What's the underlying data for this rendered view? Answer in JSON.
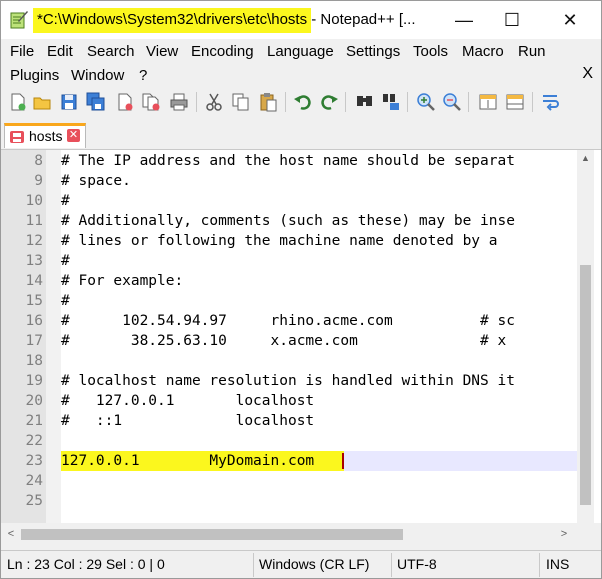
{
  "titlebar": {
    "title": "*C:\\Windows\\System32\\drivers\\etc\\hosts",
    "app_suffix": " - Notepad++ [...",
    "min": "—",
    "max": "☐",
    "close": "✕"
  },
  "menu": {
    "row1": [
      "File",
      "Edit",
      "Search",
      "View",
      "Encoding",
      "Language",
      "Settings",
      "Tools",
      "Macro",
      "Run"
    ],
    "row2": [
      "Plugins",
      "Window",
      "?"
    ],
    "close_doc": "X"
  },
  "toolbar": {
    "icons": [
      "new-file-icon",
      "open-file-icon",
      "save-icon",
      "save-all-icon",
      "close-icon",
      "close-all-icon",
      "print-icon",
      "cut-icon",
      "copy-icon",
      "paste-icon",
      "undo-icon",
      "redo-icon",
      "find-icon",
      "replace-icon",
      "zoom-in-icon",
      "zoom-out-icon",
      "sync-vertical-icon",
      "sync-horizontal-icon",
      "word-wrap-icon"
    ]
  },
  "tab": {
    "label": "hosts",
    "close": "✕"
  },
  "editor": {
    "lines": [
      {
        "num": "8",
        "text": "# The IP address and the host name should be separat"
      },
      {
        "num": "9",
        "text": "# space."
      },
      {
        "num": "10",
        "text": "#"
      },
      {
        "num": "11",
        "text": "# Additionally, comments (such as these) may be inse"
      },
      {
        "num": "12",
        "text": "# lines or following the machine name denoted by a "
      },
      {
        "num": "13",
        "text": "#"
      },
      {
        "num": "14",
        "text": "# For example:"
      },
      {
        "num": "15",
        "text": "#"
      },
      {
        "num": "16",
        "text": "#      102.54.94.97     rhino.acme.com          # sc"
      },
      {
        "num": "17",
        "text": "#       38.25.63.10     x.acme.com              # x "
      },
      {
        "num": "18",
        "text": ""
      },
      {
        "num": "19",
        "text": "# localhost name resolution is handled within DNS it"
      },
      {
        "num": "20",
        "text": "#   127.0.0.1       localhost"
      },
      {
        "num": "21",
        "text": "#   ::1             localhost"
      },
      {
        "num": "22",
        "text": ""
      },
      {
        "num": "23",
        "text": "127.0.0.1        MyDomain.com"
      },
      {
        "num": "24",
        "text": ""
      },
      {
        "num": "25",
        "text": ""
      }
    ]
  },
  "scroll": {
    "up": "▲",
    "down": "▼",
    "left": "<",
    "right": ">"
  },
  "status": {
    "position": "Ln : 23    Col : 29    Sel : 0 | 0",
    "eol": "Windows (CR LF)",
    "encoding": "UTF-8",
    "mode": "INS"
  },
  "colors": {
    "highlight": "#fbf71e",
    "current_line": "#e8e8ff",
    "tab_accent": "#f9a71c"
  }
}
